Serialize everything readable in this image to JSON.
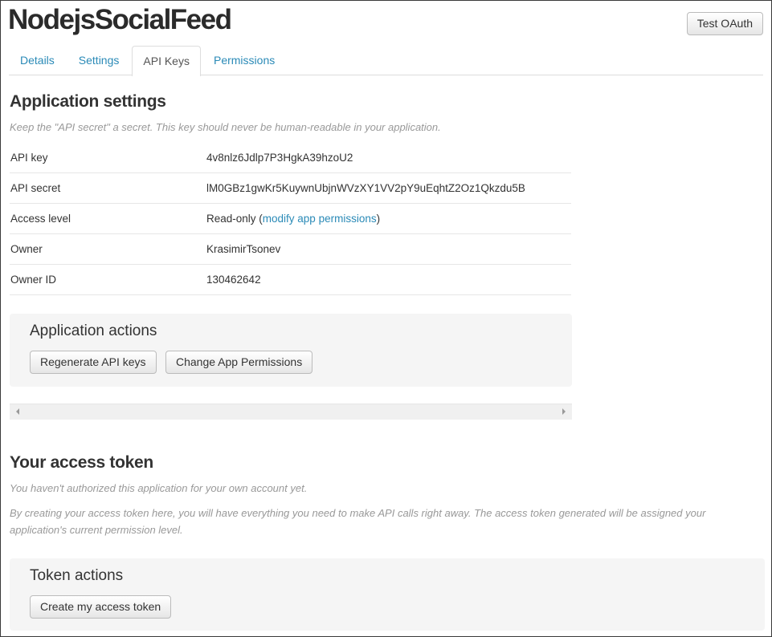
{
  "app": {
    "title": "NodejsSocialFeed",
    "test_oauth_label": "Test OAuth"
  },
  "tabs": [
    {
      "label": "Details"
    },
    {
      "label": "Settings"
    },
    {
      "label": "API Keys",
      "active": true
    },
    {
      "label": "Permissions"
    }
  ],
  "settings": {
    "heading": "Application settings",
    "hint": "Keep the \"API secret\" a secret. This key should never be human-readable in your application.",
    "rows": [
      {
        "key": "API key",
        "value": "4v8nlz6Jdlp7P3HgkA39hzoU2"
      },
      {
        "key": "API secret",
        "value": "lM0GBz1gwKr5KuywnUbjnWVzXY1VV2pY9uEqhtZ2Oz1Qkzdu5B"
      },
      {
        "key": "Access level",
        "value_prefix": "Read-only (",
        "value_link": "modify app permissions",
        "value_suffix": ")"
      },
      {
        "key": "Owner",
        "value": "KrasimirTsonev"
      },
      {
        "key": "Owner ID",
        "value": "130462642"
      }
    ]
  },
  "app_actions": {
    "title": "Application actions",
    "regenerate_label": "Regenerate API keys",
    "change_permissions_label": "Change App Permissions"
  },
  "token": {
    "heading": "Your access token",
    "hint1": "You haven't authorized this application for your own account yet.",
    "hint2": "By creating your access token here, you will have everything you need to make API calls right away. The access token generated will be assigned your application's current permission level."
  },
  "token_actions": {
    "title": "Token actions",
    "create_label": "Create my access token"
  },
  "colors": {
    "link": "#2a8ab7",
    "panel_bg": "#f5f5f5"
  },
  "icons": [
    "scroll-left-arrow-icon",
    "scroll-right-arrow-icon"
  ]
}
